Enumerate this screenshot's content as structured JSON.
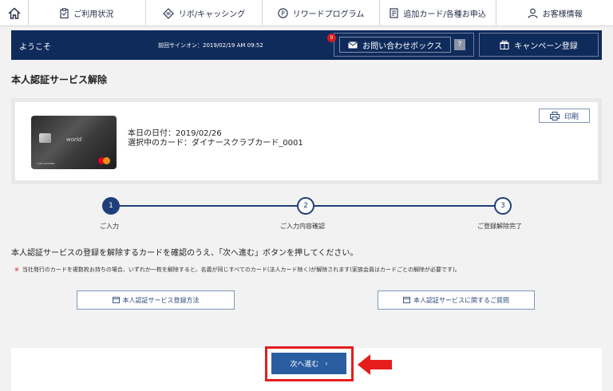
{
  "nav": {
    "items": [
      {
        "label": "ご利用状況",
        "icon": "clipboard-icon"
      },
      {
        "label": "リボ/キャッシング",
        "icon": "diamond-arrows-icon"
      },
      {
        "label": "リワードプログラム",
        "icon": "points-icon"
      },
      {
        "label": "追加カード/各種お申込",
        "icon": "document-icon"
      },
      {
        "label": "お客様情報",
        "icon": "user-icon"
      }
    ]
  },
  "welcome": {
    "greeting": "ようこそ",
    "last_login": "前回サインオン：2019/02/19 AM 09:52",
    "inbox_label": "お問い合わせボックス",
    "inbox_badge": "0",
    "help_label": "?",
    "campaign_label": "キャンペーン登録"
  },
  "page": {
    "title": "本人認証サービス解除"
  },
  "card": {
    "brand_text": "world",
    "member_text": "CARD MEMBER",
    "date_line": "本日の日付：2019/02/26",
    "card_line": "選択中のカード：ダイナースクラブカード_0001",
    "print_label": "印刷"
  },
  "steps": [
    {
      "num": "1",
      "label": "ご入力",
      "active": true
    },
    {
      "num": "2",
      "label": "ご入力内容確認",
      "active": false
    },
    {
      "num": "3",
      "label": "ご登録解除完了",
      "active": false
    }
  ],
  "instruction": "本人認証サービスの登録を解除するカードを確認のうえ、「次へ進む」ボタンを押してください。",
  "note": {
    "mark": "※",
    "text": "当社発行のカードを複数枚お持ちの場合、いずれか一枚を解除すると、名義が同じすべてのカード(法人カード除く)が解除されます(家族会員はカードごとの解除が必要です)。"
  },
  "links": {
    "how_to": "本人認証サービス登録方法",
    "faq": "本人認証サービスに関するご質問"
  },
  "next": {
    "label": "次へ進む",
    "chevron": "›"
  },
  "colors": {
    "navy": "#0f2b5b",
    "button_blue": "#2a5ea0",
    "highlight_red": "#e51d1d"
  }
}
